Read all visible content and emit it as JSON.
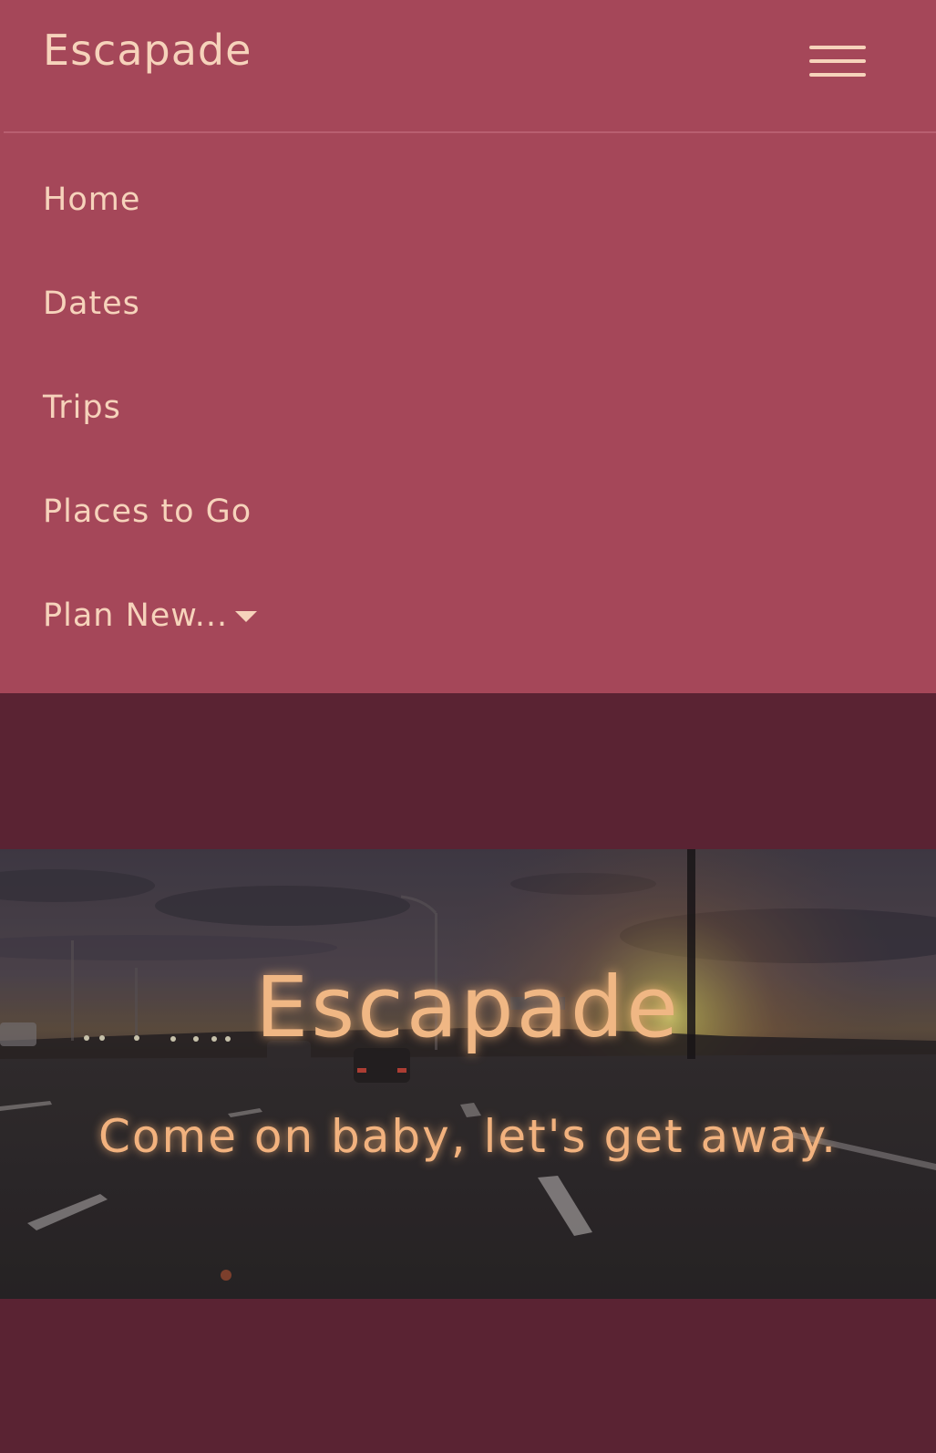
{
  "navbar": {
    "brand": "Escapade",
    "toggle_icon": "hamburger-menu-icon",
    "items": [
      {
        "label": "Home"
      },
      {
        "label": "Dates"
      },
      {
        "label": "Trips"
      },
      {
        "label": "Places to Go"
      },
      {
        "label": "Plan New..."
      }
    ],
    "dropdown_icon": "caret-down-icon"
  },
  "hero": {
    "title": "Escapade",
    "subtitle": "Come on baby, let's get away.",
    "image": "highway-sunset-photo"
  },
  "colors": {
    "navbar_bg": "#a54759",
    "page_bg": "#5a2333",
    "nav_text": "#f6d3bb",
    "hero_text": "#f0b784"
  }
}
